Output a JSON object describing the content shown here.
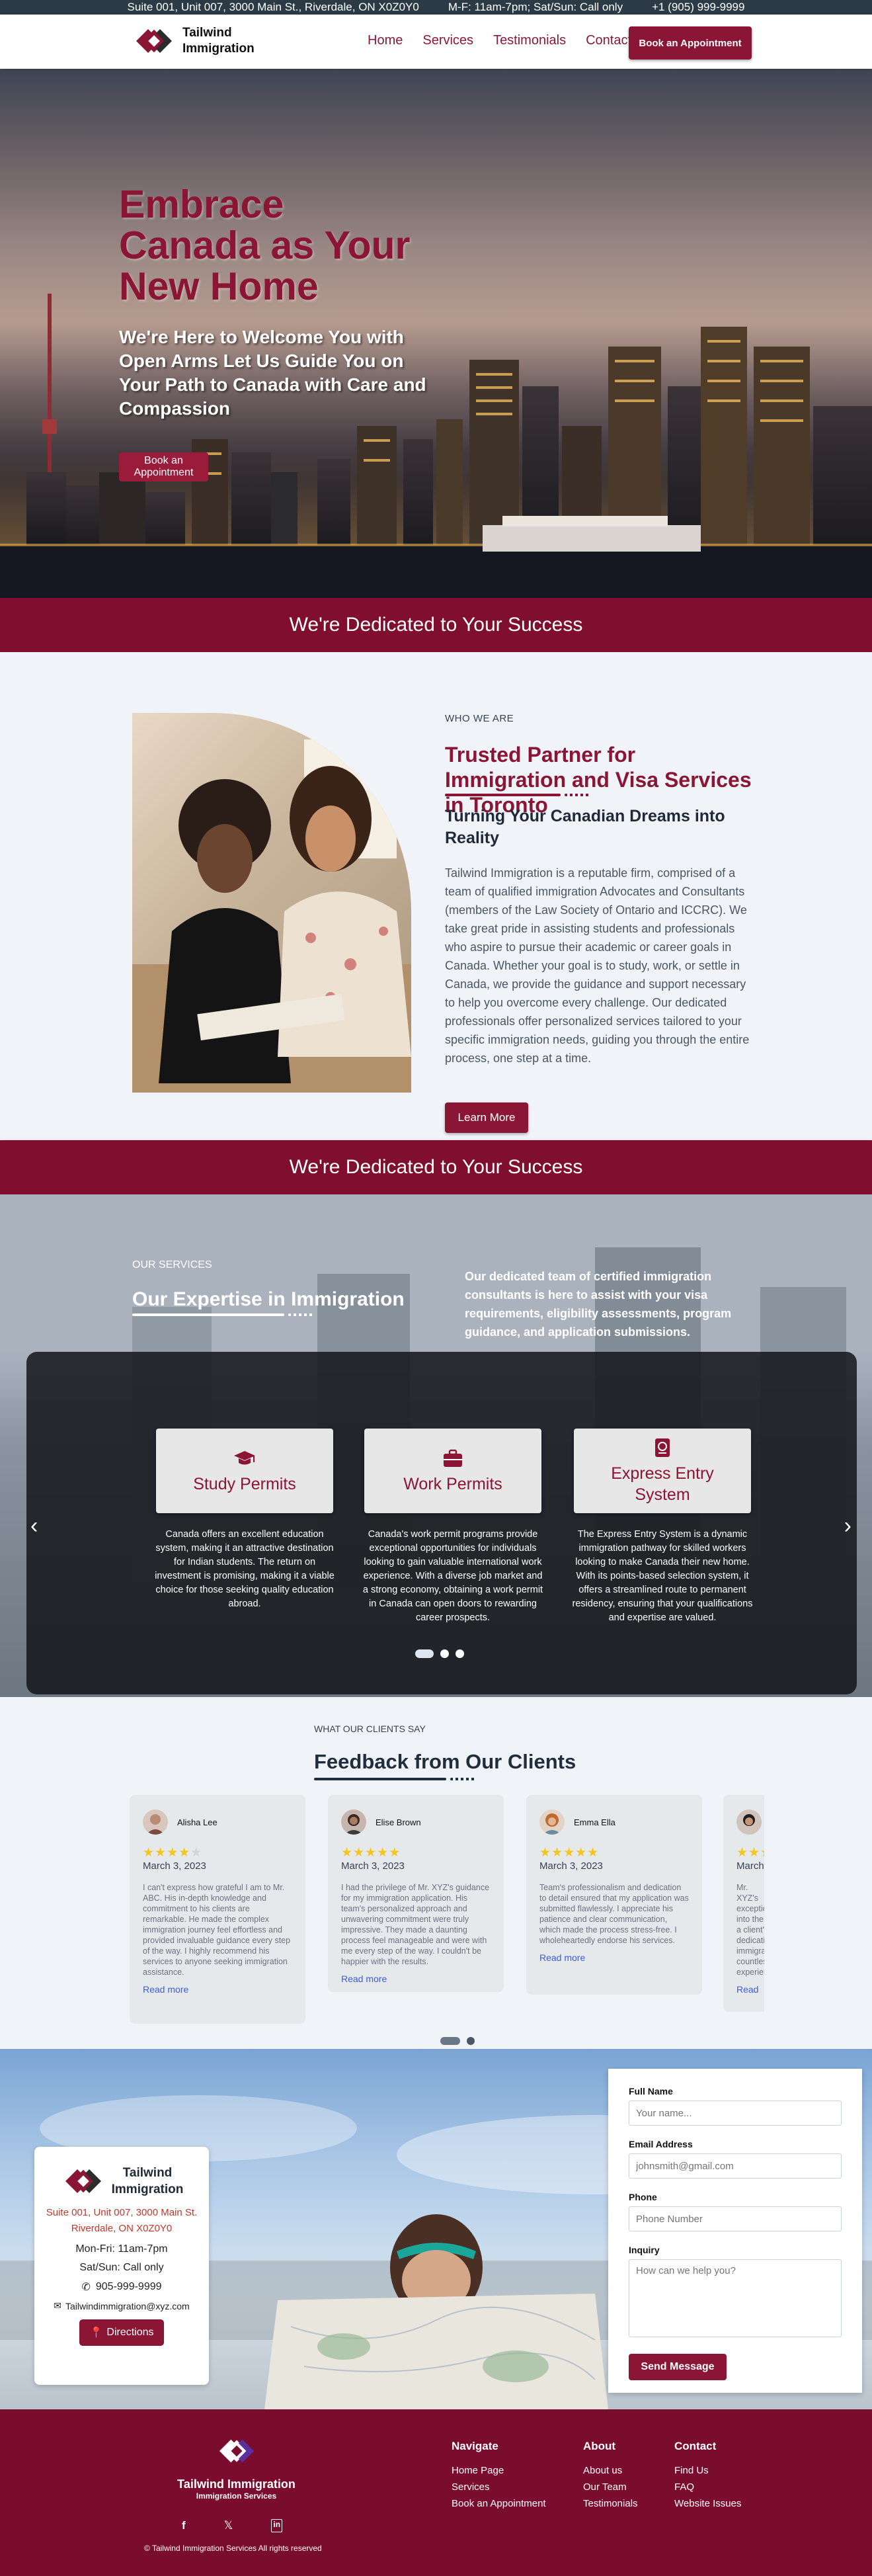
{
  "topbar": {
    "address": "Suite 001, Unit 007, 3000 Main St., Riverdale, ON X0Z0Y0",
    "hours": "M-F: 11am-7pm; Sat/Sun: Call only",
    "phone": "+1 (905) 999-9999"
  },
  "header": {
    "logo_line1": "Tailwind",
    "logo_line2": "Immigration",
    "nav": [
      "Home",
      "Services",
      "Testimonials",
      "Contact"
    ],
    "cta": "Book an Appointment"
  },
  "hero": {
    "title": "Embrace Canada as Your New Home",
    "subtitle": "We're Here to Welcome You with Open Arms Let Us Guide You on Your Path to Canada with Care and Compassion",
    "cta": "Book an Appointment"
  },
  "banner": {
    "text": "We're Dedicated to Your Success"
  },
  "about": {
    "eyebrow": "WHO WE ARE",
    "title": "Trusted Partner for Immigration and Visa Services in Toronto",
    "subtitle": "Turning Your Canadian Dreams into Reality",
    "body": "Tailwind Immigration is a reputable firm, comprised of a team of qualified immigration Advocates and Consultants (members of the Law Society of Ontario and ICCRC). We take great pride in assisting students and professionals who aspire to pursue their academic or career goals in Canada. Whether your goal is to study, work, or settle in Canada, we provide the guidance and support necessary to help you overcome every challenge. Our dedicated professionals offer personalized services tailored to your specific immigration needs, guiding you through the entire process, one step at a time.",
    "cta": "Learn More"
  },
  "services": {
    "eyebrow": "OUR SERVICES",
    "title": "Our Expertise in Immigration",
    "description": "Our dedicated team of certified immigration consultants is here to assist with your visa requirements, eligibility assessments, program guidance, and application submissions.",
    "cards": [
      {
        "title": "Study Permits",
        "icon": "graduation-cap-icon",
        "text": "Canada offers an excellent education system, making it an attractive destination for Indian students. The return on investment is promising, making it a viable choice for those seeking quality education abroad."
      },
      {
        "title": "Work Permits",
        "icon": "briefcase-icon",
        "text": "Canada's work permit programs provide exceptional opportunities for individuals looking to gain valuable international work experience. With a diverse job market and a strong economy, obtaining a work permit in Canada can open doors to rewarding career prospects."
      },
      {
        "title": "Express Entry System",
        "icon": "passport-icon",
        "text": "The Express Entry System is a dynamic immigration pathway for skilled workers looking to make Canada their new home. With its points-based selection system, it offers a streamlined route to permanent residency, ensuring that your qualifications and expertise are valued."
      }
    ],
    "prev": "‹",
    "next": "›"
  },
  "testimonials": {
    "eyebrow": "WHAT OUR CLIENTS SAY",
    "title": "Feedback from Our Clients",
    "items": [
      {
        "name": "Alisha Lee",
        "stars": "★★★★★",
        "rating": 4,
        "date": "March 3, 2023",
        "text": "I can't express how grateful I am to Mr. ABC. His in-depth knowledge and commitment to his clients are remarkable. He made the complex immigration journey feel effortless and provided invaluable guidance every step of the way. I highly recommend his services to anyone seeking immigration assistance.",
        "more": "Read more"
      },
      {
        "name": "Elise Brown",
        "stars": "★★★★★",
        "rating": 5,
        "date": "March 3, 2023",
        "text": "I had the privilege of Mr. XYZ's guidance for my immigration application. His team's personalized approach and unwavering commitment were truly impressive. They made a daunting process feel manageable and were with me every step of the way. I couldn't be happier with the results.",
        "more": "Read more"
      },
      {
        "name": "Emma Ella",
        "stars": "★★★★★",
        "rating": 5,
        "date": "March 3, 2023",
        "text": "Team's professionalism and dedication to detail ensured that my application was submitted flawlessly. I appreciate his patience and clear communication, which made the process stress-free. I wholeheartedly endorse his services.",
        "more": "Read more"
      },
      {
        "name": "",
        "stars": "★★★★★",
        "rating": 5,
        "date": "March",
        "text": "Mr. XYZ's exceptional into the a client's dedication immigration countless experience",
        "more": "Read"
      }
    ]
  },
  "contact": {
    "logo_line1": "Tailwind",
    "logo_line2": "Immigration",
    "address_line1": "Suite 001, Unit 007, 3000 Main St.",
    "address_line2": "Riverdale, ON X0Z0Y0",
    "hours1": "Mon-Fri: 11am-7pm",
    "hours2": "Sat/Sun: Call only",
    "phone": "905-999-9999",
    "email": "Tailwindimmigration@xyz.com",
    "directions": "Directions",
    "form": {
      "name_label": "Full Name",
      "name_placeholder": "Your name...",
      "email_label": "Email Address",
      "email_placeholder": "johnsmith@gmail.com",
      "phone_label": "Phone",
      "phone_placeholder": "Phone Number",
      "inquiry_label": "Inquiry",
      "inquiry_placeholder": "How can we help you?",
      "submit": "Send Message"
    }
  },
  "footer": {
    "logo_name": "Tailwind Immigration",
    "logo_sub": "Immigration Services",
    "social": [
      "f",
      "𝕏",
      "in"
    ],
    "copyright": "© Tailwind Immigration Services All rights reserved",
    "columns": [
      {
        "title": "Navigate",
        "links": [
          "Home Page",
          "Services",
          "Book an Appointment"
        ]
      },
      {
        "title": "About",
        "links": [
          "About us",
          "Our Team",
          "Testimonials"
        ]
      },
      {
        "title": "Contact",
        "links": [
          "Find Us",
          "FAQ",
          "Website Issues"
        ]
      }
    ]
  },
  "colors": {
    "brand": "#8b1535",
    "banner": "#800f2f",
    "footer": "#7a0d2d",
    "topbar": "#2b3a44",
    "star": "#f5c518"
  }
}
